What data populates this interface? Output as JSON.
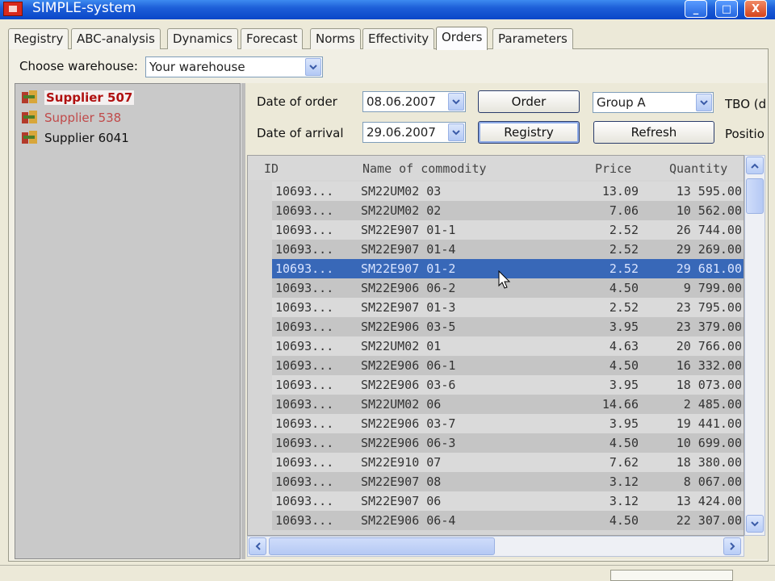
{
  "window": {
    "title": "SIMPLE-system",
    "controls": {
      "minimize": "_",
      "maximize": "□",
      "close": "X"
    }
  },
  "tabs": [
    {
      "label": "Registry",
      "active": false
    },
    {
      "label": "ABC-analysis",
      "active": false
    },
    {
      "label": "Dynamics",
      "active": false
    },
    {
      "label": "Forecast",
      "active": false
    },
    {
      "label": "Norms",
      "active": false
    },
    {
      "label": "Effectivity",
      "active": false
    },
    {
      "label": "Orders",
      "active": true
    },
    {
      "label": "Parameters",
      "active": false
    }
  ],
  "warehouse": {
    "label": "Choose warehouse:",
    "value": "Your warehouse"
  },
  "suppliers": [
    {
      "label": "Supplier 507",
      "state": "selected"
    },
    {
      "label": "Supplier 538",
      "state": "alt"
    },
    {
      "label": "Supplier 6041",
      "state": "normal"
    }
  ],
  "order_panel": {
    "date_of_order_label": "Date of order",
    "date_of_order_value": "08.06.2007",
    "date_of_arrival_label": "Date of arrival",
    "date_of_arrival_value": "29.06.2007",
    "order_button": "Order",
    "registry_button": "Registry",
    "group_value": "Group A",
    "refresh_button": "Refresh",
    "tbo_label": "TBO (d",
    "position_label": "Positio"
  },
  "grid": {
    "columns": [
      "ID",
      "Name of commodity",
      "Price",
      "Quantity"
    ],
    "selected_index": 4,
    "rows": [
      {
        "id": "10693...",
        "name": "SM22UM02 03",
        "price": "13.09",
        "qty": "13 595.00"
      },
      {
        "id": "10693...",
        "name": "SM22UM02 02",
        "price": "7.06",
        "qty": "10 562.00"
      },
      {
        "id": "10693...",
        "name": "SM22E907 01-1",
        "price": "2.52",
        "qty": "26 744.00"
      },
      {
        "id": "10693...",
        "name": "SM22E907 01-4",
        "price": "2.52",
        "qty": "29 269.00"
      },
      {
        "id": "10693...",
        "name": "SM22E907 01-2",
        "price": "2.52",
        "qty": "29 681.00"
      },
      {
        "id": "10693...",
        "name": "SM22E906 06-2",
        "price": "4.50",
        "qty": "9 799.00"
      },
      {
        "id": "10693...",
        "name": "SM22E907 01-3",
        "price": "2.52",
        "qty": "23 795.00"
      },
      {
        "id": "10693...",
        "name": "SM22E906 03-5",
        "price": "3.95",
        "qty": "23 379.00"
      },
      {
        "id": "10693...",
        "name": "SM22UM02 01",
        "price": "4.63",
        "qty": "20 766.00"
      },
      {
        "id": "10693...",
        "name": "SM22E906 06-1",
        "price": "4.50",
        "qty": "16 332.00"
      },
      {
        "id": "10693...",
        "name": "SM22E906 03-6",
        "price": "3.95",
        "qty": "18 073.00"
      },
      {
        "id": "10693...",
        "name": "SM22UM02 06",
        "price": "14.66",
        "qty": "2 485.00"
      },
      {
        "id": "10693...",
        "name": "SM22E906 03-7",
        "price": "3.95",
        "qty": "19 441.00"
      },
      {
        "id": "10693...",
        "name": "SM22E906 06-3",
        "price": "4.50",
        "qty": "10 699.00"
      },
      {
        "id": "10693...",
        "name": "SM22E910 07",
        "price": "7.62",
        "qty": "18 380.00"
      },
      {
        "id": "10693...",
        "name": "SM22E907 08",
        "price": "3.12",
        "qty": "8 067.00"
      },
      {
        "id": "10693...",
        "name": "SM22E907 06",
        "price": "3.12",
        "qty": "13 424.00"
      },
      {
        "id": "10693...",
        "name": "SM22E906 06-4",
        "price": "4.50",
        "qty": "22 307.00"
      }
    ]
  },
  "icons": {
    "supplier_icon": "warehouse-boxes-icon",
    "dropdown_icon": "chevron-down-icon",
    "scroll_up": "arrow-up-icon",
    "scroll_down": "arrow-down-icon",
    "scroll_left": "arrow-left-icon",
    "scroll_right": "arrow-right-icon",
    "cursor": "mouse-pointer-icon"
  },
  "colors": {
    "selected_row": "#3868b8",
    "selected_supplier": "#b01010",
    "titlebar": "#1d5fd8"
  }
}
